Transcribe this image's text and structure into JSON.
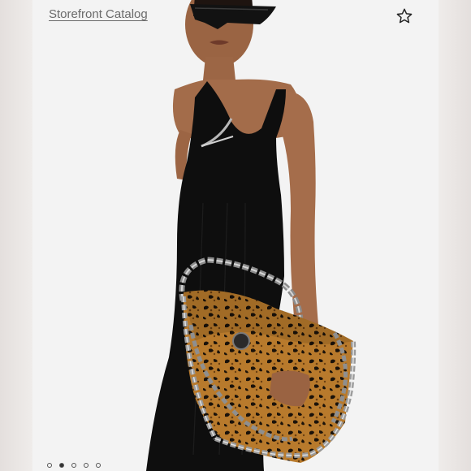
{
  "header": {
    "catalog_link_label": "Storefront Catalog"
  },
  "icons": {
    "favorite": "star-outline-icon"
  },
  "gallery": {
    "slide_count": 5,
    "active_slide": 2
  },
  "colors": {
    "background": "#f2f2f2",
    "dress": "#0d0d0d",
    "skin": "#a9734f",
    "leopard_base": "#b5782a",
    "leopard_spot": "#1a120a",
    "chain": "#8a8a8a"
  }
}
